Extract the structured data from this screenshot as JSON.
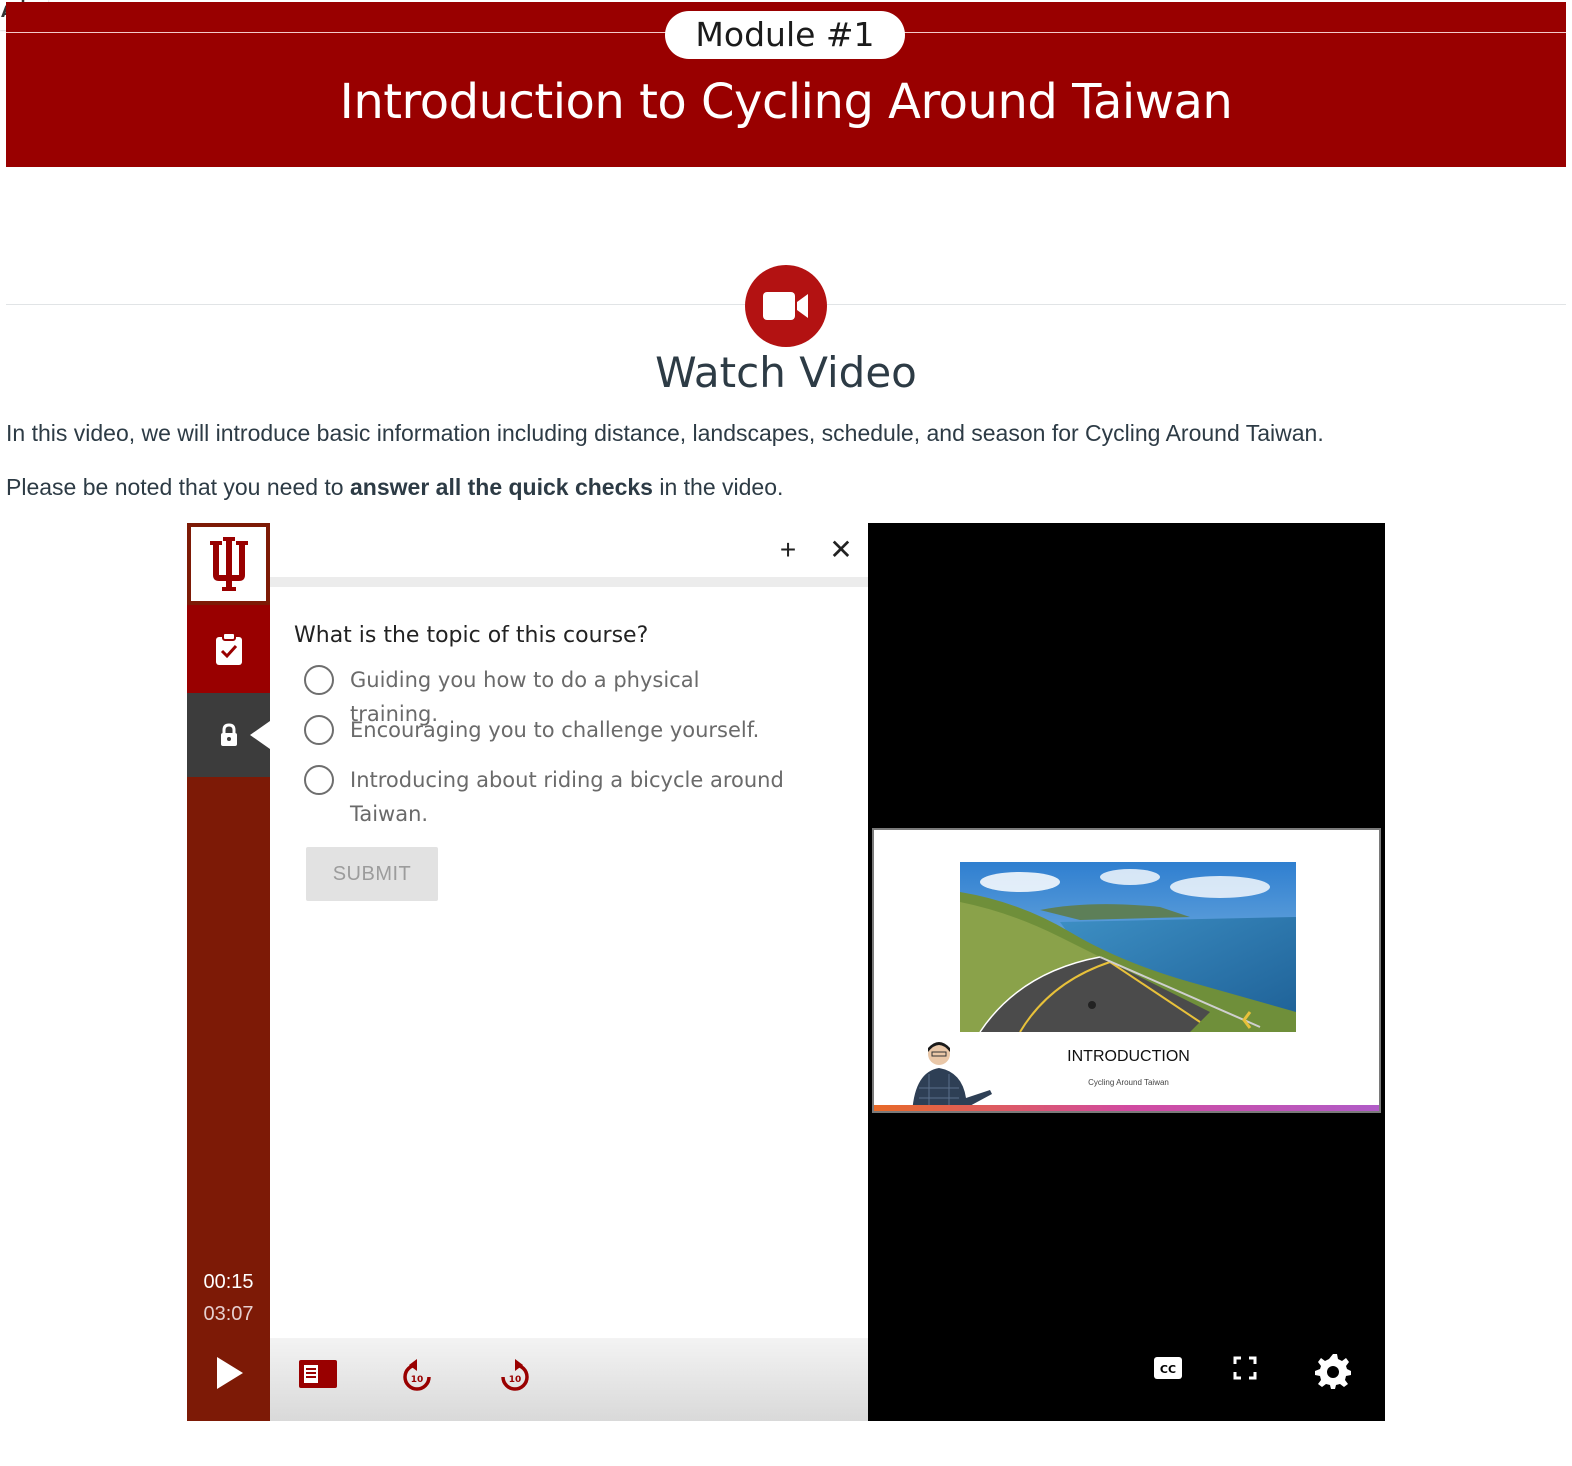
{
  "banner": {
    "module_label": "Module #1",
    "title": "Introduction to Cycling Around Taiwan"
  },
  "section": {
    "icon": "video-camera-icon",
    "title": "Watch Video",
    "paragraph1": "In this video, we will introduce basic information including distance, landscapes, schedule, and season for Cycling Around Taiwan.",
    "paragraph2_pre": "Please be noted that you need to ",
    "paragraph2_bold": "answer all the quick checks",
    "paragraph2_post": " in the video."
  },
  "player": {
    "sidebar": {
      "logo_icon": "iu-trident-icon",
      "quiz_icon": "clipboard-check-icon",
      "lock_icon": "lock-icon",
      "current_time": "00:15",
      "total_time": "03:07"
    },
    "quiz": {
      "expand_label": "+",
      "close_label": "✕",
      "question": "What is the topic of this course?",
      "options": [
        "Guiding you how to do a physical training.",
        "Encouraging you to challenge yourself.",
        "Introducing about riding a bicycle around Taiwan."
      ],
      "submit_label": "SUBMIT"
    },
    "controls": {
      "rewind_label": "10",
      "forward_label": "10"
    },
    "slide": {
      "title": "INTRODUCTION",
      "subtitle": "Cycling Around Taiwan"
    }
  },
  "colors": {
    "brand_red": "#990000",
    "sidebar_red": "#7d1a06",
    "text": "#2d3b45"
  }
}
